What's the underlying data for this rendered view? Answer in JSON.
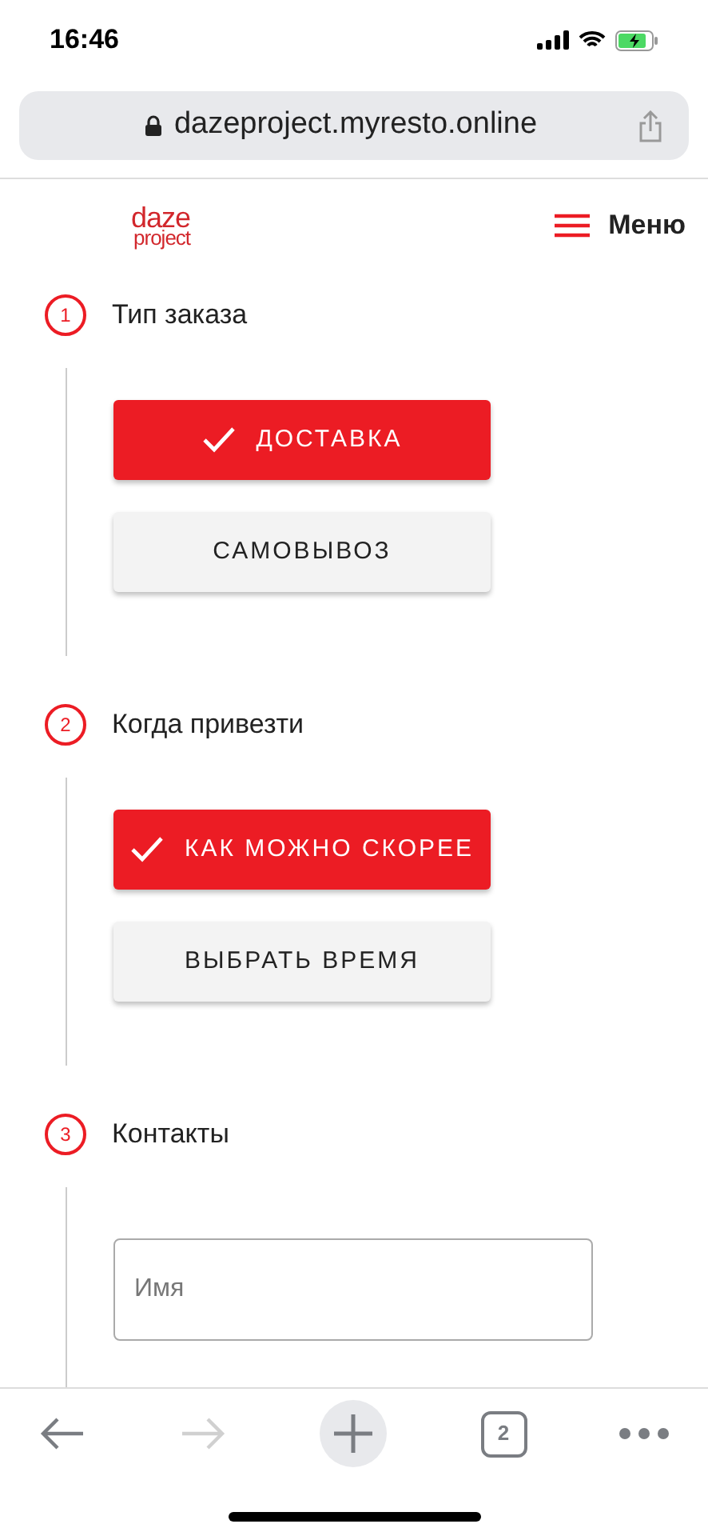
{
  "status_bar": {
    "time": "16:46"
  },
  "browser": {
    "url": "dazeproject.myresto.online"
  },
  "header": {
    "logo_top": "daze",
    "logo_bottom": "project",
    "menu_label": "Меню"
  },
  "steps": [
    {
      "number": "1",
      "title": "Тип заказа",
      "kind": "options",
      "options": [
        {
          "label": "ДОСТАВКА",
          "selected": true
        },
        {
          "label": "САМОВЫВОЗ",
          "selected": false
        }
      ]
    },
    {
      "number": "2",
      "title": "Когда привезти",
      "kind": "options",
      "options": [
        {
          "label": "КАК МОЖНО СКОРЕЕ",
          "selected": true
        },
        {
          "label": "ВЫБРАТЬ ВРЕМЯ",
          "selected": false
        }
      ]
    },
    {
      "number": "3",
      "title": "Контакты",
      "kind": "fields",
      "fields": [
        {
          "placeholder": "Имя"
        }
      ]
    }
  ],
  "toolbar": {
    "back_disabled": false,
    "forward_disabled": true,
    "tab_count": "2"
  }
}
